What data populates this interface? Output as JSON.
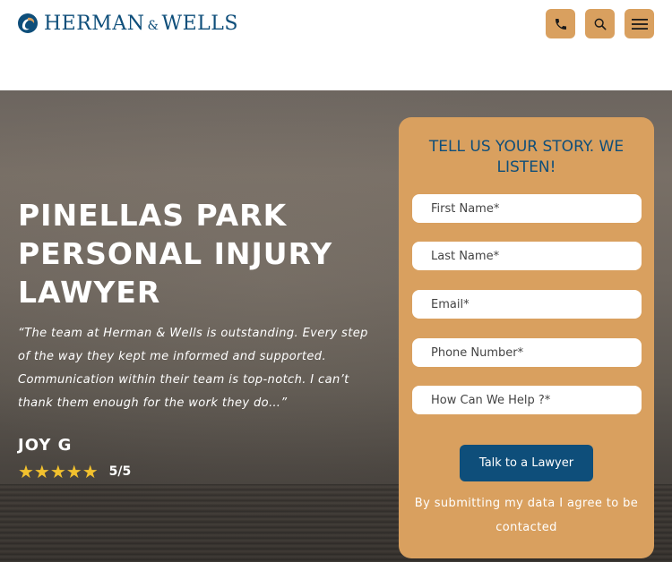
{
  "header": {
    "logo": {
      "name_part1": "HERMAN",
      "ampersand": "&",
      "name_part2": "WELLS",
      "icon": "swirl-logo-icon"
    },
    "buttons": [
      {
        "icon": "phone-icon"
      },
      {
        "icon": "search-icon"
      },
      {
        "icon": "hamburger-menu-icon"
      }
    ]
  },
  "hero": {
    "title": "PINELLAS PARK PERSONAL INJURY LAWYER",
    "testimonial": {
      "quote": "“The team at Herman & Wells is outstanding. Every step of the way they kept me informed and supported. Communication within their team is top-notch. I can’t thank them enough for the work they do…”",
      "author": "JOY G",
      "stars": 5,
      "stars_display": "★★★★★",
      "score": "5/5"
    }
  },
  "form": {
    "title": "TELL US YOUR STORY. WE LISTEN!",
    "fields": {
      "first_name": {
        "placeholder": "First Name*",
        "value": ""
      },
      "last_name": {
        "placeholder": "Last Name*",
        "value": ""
      },
      "email": {
        "placeholder": "Email*",
        "value": ""
      },
      "phone": {
        "placeholder": "Phone Number*",
        "value": ""
      },
      "help": {
        "placeholder": "How Can We Help ?*",
        "value": ""
      }
    },
    "submit_label": "Talk to a Lawyer",
    "consent_text": "By submitting my data I agree to be contacted"
  },
  "colors": {
    "brand_blue": "#0e4e7a",
    "accent_gold": "#d9a05f",
    "star_yellow": "#f2c12e"
  }
}
